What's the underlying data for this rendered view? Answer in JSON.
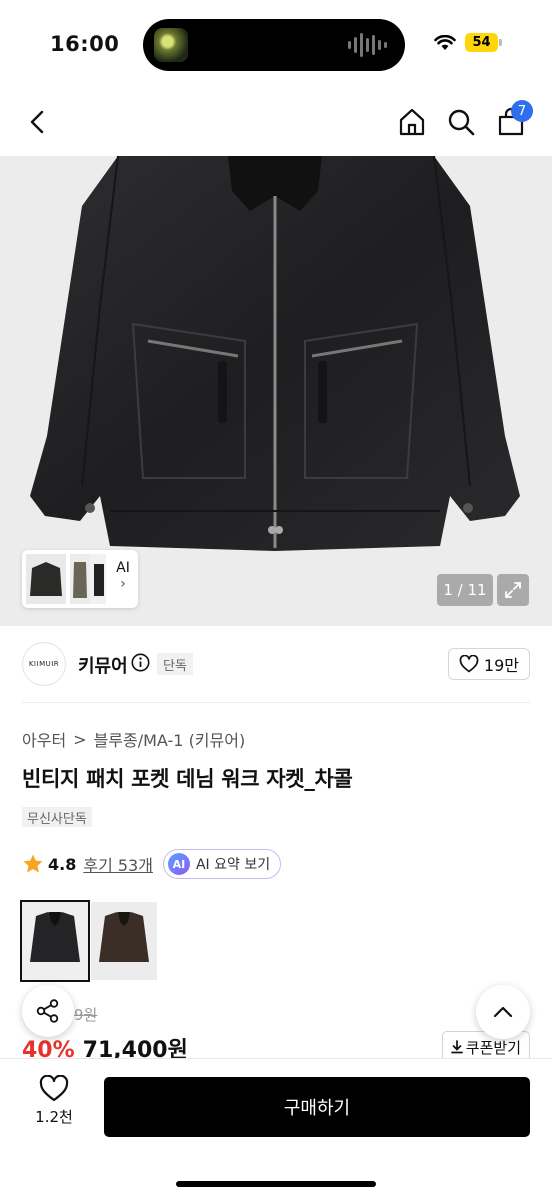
{
  "status_bar": {
    "time": "16:00",
    "battery": "54"
  },
  "nav": {
    "cart_count": "7"
  },
  "gallery": {
    "ai_label": "AI",
    "ai_arrow": "›",
    "page_counter": "1 / 11"
  },
  "brand": {
    "logo_text": "KIIMUIR",
    "name": "키뮤어",
    "exclusive_tag": "단독",
    "likes": "19만"
  },
  "breadcrumb": {
    "category": "아우터",
    "separator": ">",
    "subcategory": "블루종/MA-1 (키뮤어)"
  },
  "product": {
    "title": "빈티지 패치 포켓 데님 워크 자켓_차콜",
    "store_tag": "무신사단독",
    "rating": "4.8",
    "reviews_label": "후기 53개",
    "ai_badge": "AI",
    "ai_summary_label": "AI 요약 보기",
    "original_price_visible": "9원",
    "discount": "40%",
    "price": "71,400원",
    "coupon_label": "쿠폰받기"
  },
  "colors": {
    "selected_swatch": "charcoal",
    "swatches": [
      "charcoal",
      "brown"
    ]
  },
  "bottom_bar": {
    "wish_count": "1.2천",
    "buy_label": "구매하기"
  }
}
